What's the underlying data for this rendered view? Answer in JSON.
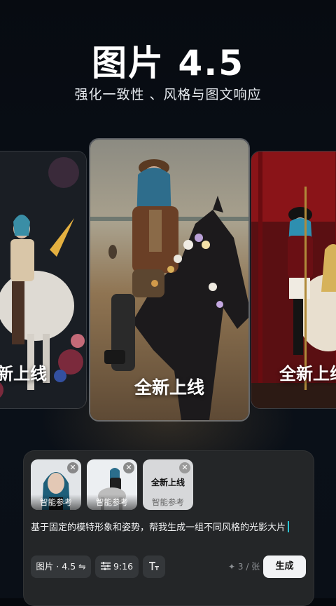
{
  "header": {
    "title": "图片 4.5",
    "subtitle": "强化一致性 、风格与图文响应"
  },
  "cards": [
    {
      "caption": "全新上线",
      "icon": "unicorn-rider-image"
    },
    {
      "caption": "全新上线",
      "icon": "horse-rider-image"
    },
    {
      "caption": "全新上线",
      "icon": "carousel-rider-image"
    }
  ],
  "composer": {
    "references": [
      {
        "label": "智能参考",
        "icon": "portrait-thumbnail"
      },
      {
        "label": "智能参考",
        "icon": "rider-thumbnail"
      },
      {
        "label": "智能参考",
        "title": "全新上线"
      }
    ],
    "close_glyph": "✕",
    "prompt_text": "基于固定的模特形象和姿势，帮我生成一组不同风格的光影大片",
    "toolbar": {
      "model_label": "图片 · 4.5 ⇋",
      "ratio_label": "9:16",
      "text_icon": "text-size-icon",
      "count_label": "✦ 3 / 张",
      "generate_label": "生成"
    }
  },
  "colors": {
    "background": "#05080d",
    "panel": "#242628",
    "cursor": "#2bc7d6",
    "generate_button": "#f2f3f5"
  }
}
